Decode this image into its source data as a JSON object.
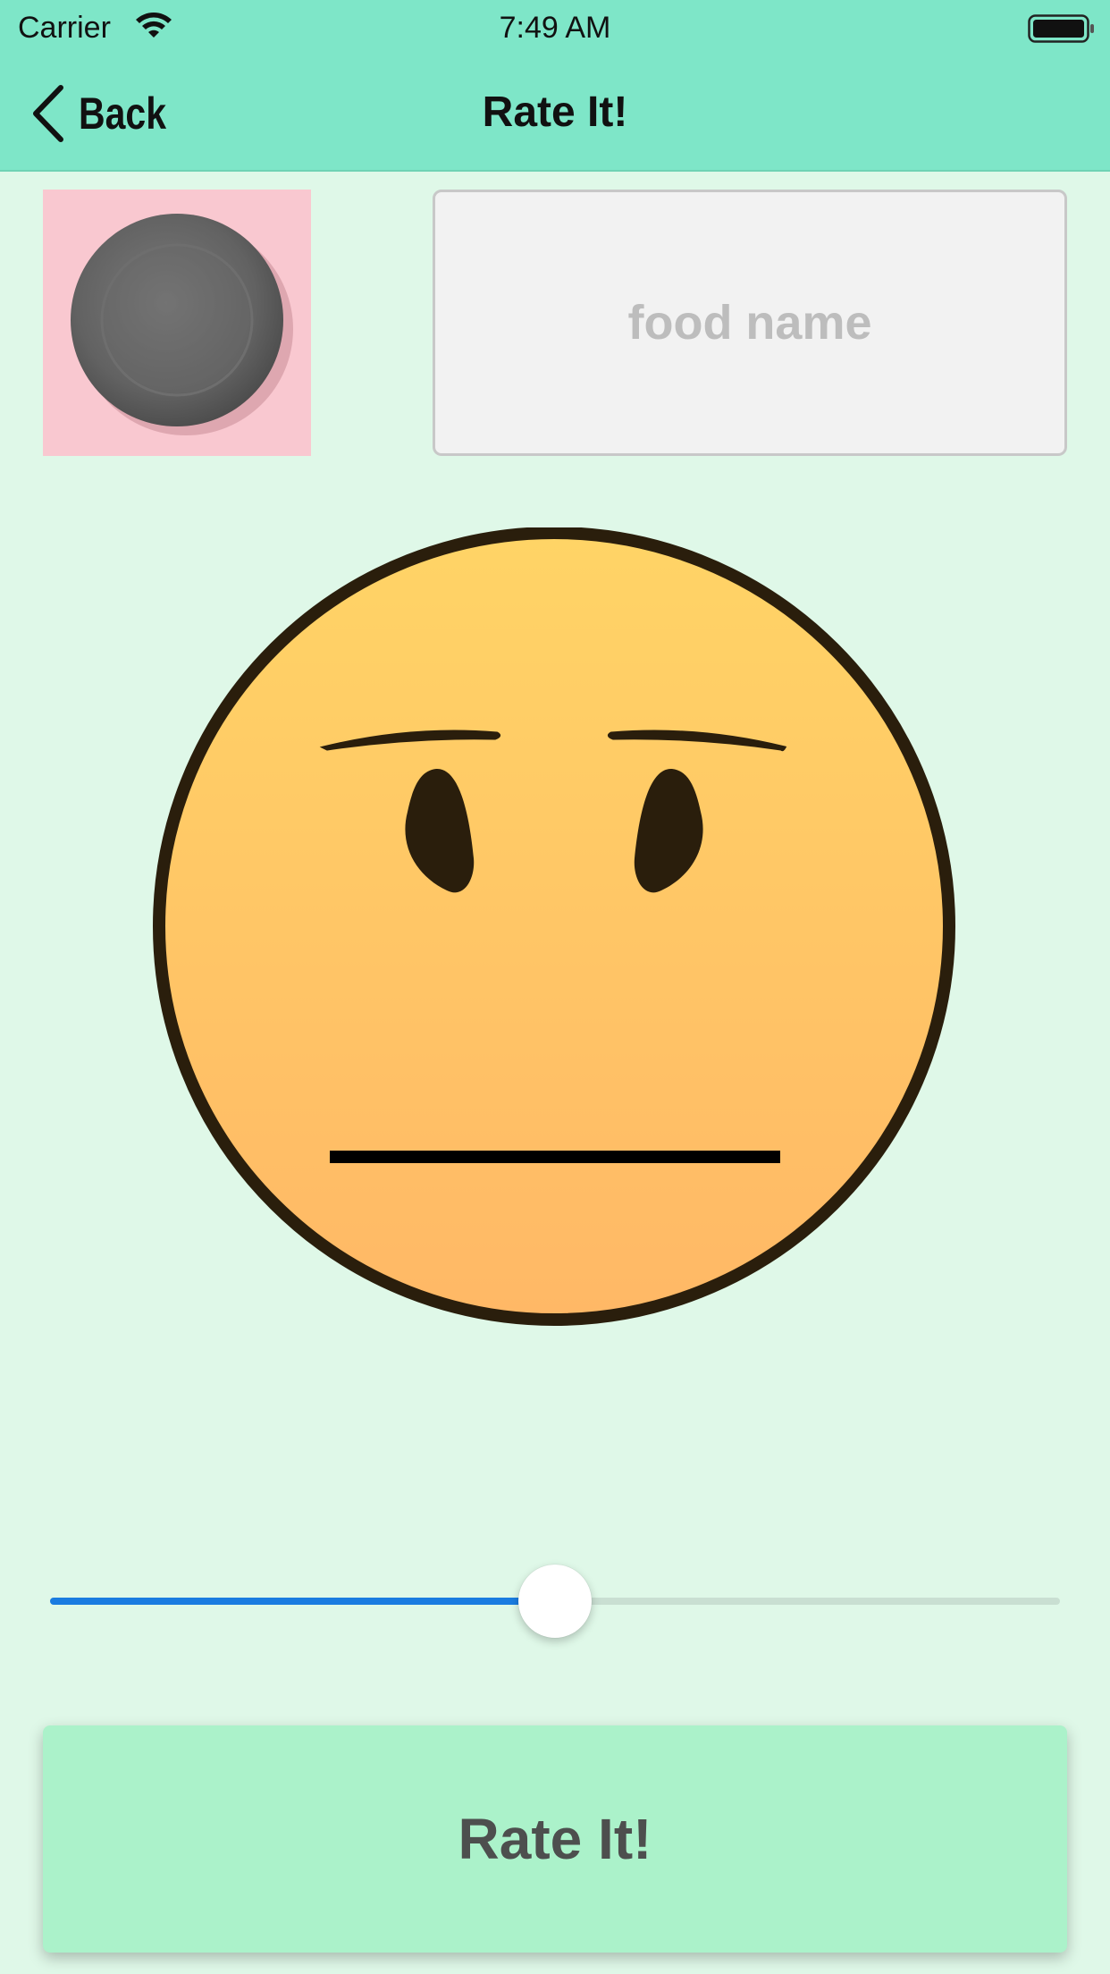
{
  "status_bar": {
    "carrier": "Carrier",
    "time": "7:49 AM",
    "icons": [
      "wifi-icon",
      "battery-icon"
    ]
  },
  "nav": {
    "back_label": "Back",
    "title": "Rate It!",
    "back_icon": "chevron-left-icon"
  },
  "food": {
    "photo": "empty-plate-image",
    "name_value": "",
    "name_placeholder": "food name"
  },
  "rating": {
    "face": "neutral-face-icon",
    "slider_value": 0.5
  },
  "rate_button_label": "Rate It!",
  "colors": {
    "bar_background": "#7ee6c8",
    "page_background": "#dff8e8",
    "button_background": "#abf2ca",
    "slider_fill": "#1a7ce0",
    "face_fill_top": "#ffd466",
    "face_fill_bottom": "#ffb866"
  }
}
